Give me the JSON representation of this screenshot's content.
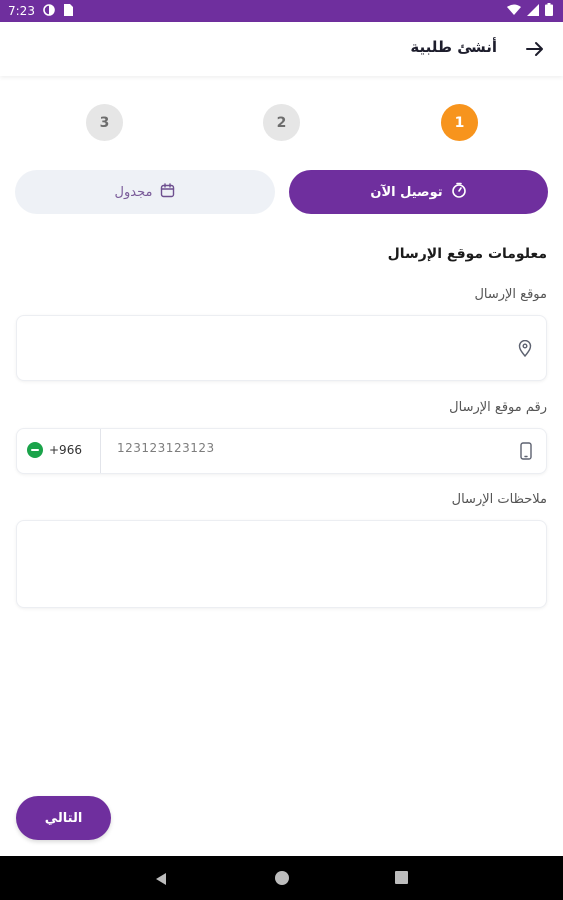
{
  "status_bar": {
    "time": "7:23",
    "icons": [
      "sync-icon",
      "sim-card-icon",
      "wifi-icon",
      "cell-signal-icon",
      "battery-icon"
    ],
    "bg_color": "#6f2f9e"
  },
  "app_bar": {
    "title": "أنشئ طلبية",
    "back_icon": "arrow-right-icon"
  },
  "stepper": {
    "steps": [
      {
        "label": "1",
        "active": true
      },
      {
        "label": "2",
        "active": false
      },
      {
        "label": "3",
        "active": false
      }
    ],
    "active_color": "#f7941d"
  },
  "delivery_toggle": {
    "now_label": "توصيل الآن",
    "now_icon": "timer-icon",
    "scheduled_label": "مجدول",
    "scheduled_icon": "calendar-icon",
    "selected": "now",
    "accent_color": "#6f2f9e"
  },
  "form": {
    "section_title": "معلومات موقع الإرسال",
    "location_label": "موقع الإرسال",
    "location_value": "",
    "location_icon": "location-pin-icon",
    "phone_label": "رقم موقع الإرسال",
    "phone_placeholder": "123123123123",
    "phone_icon": "mobile-phone-icon",
    "country_code": "+966",
    "country_flag": "saudi-flag-icon",
    "notes_label": "ملاحظات الإرسال",
    "notes_value": ""
  },
  "footer": {
    "next_label": "التالي"
  },
  "nav_bar": {
    "icons": [
      "nav-back-icon",
      "nav-home-icon",
      "nav-recent-icon"
    ]
  }
}
